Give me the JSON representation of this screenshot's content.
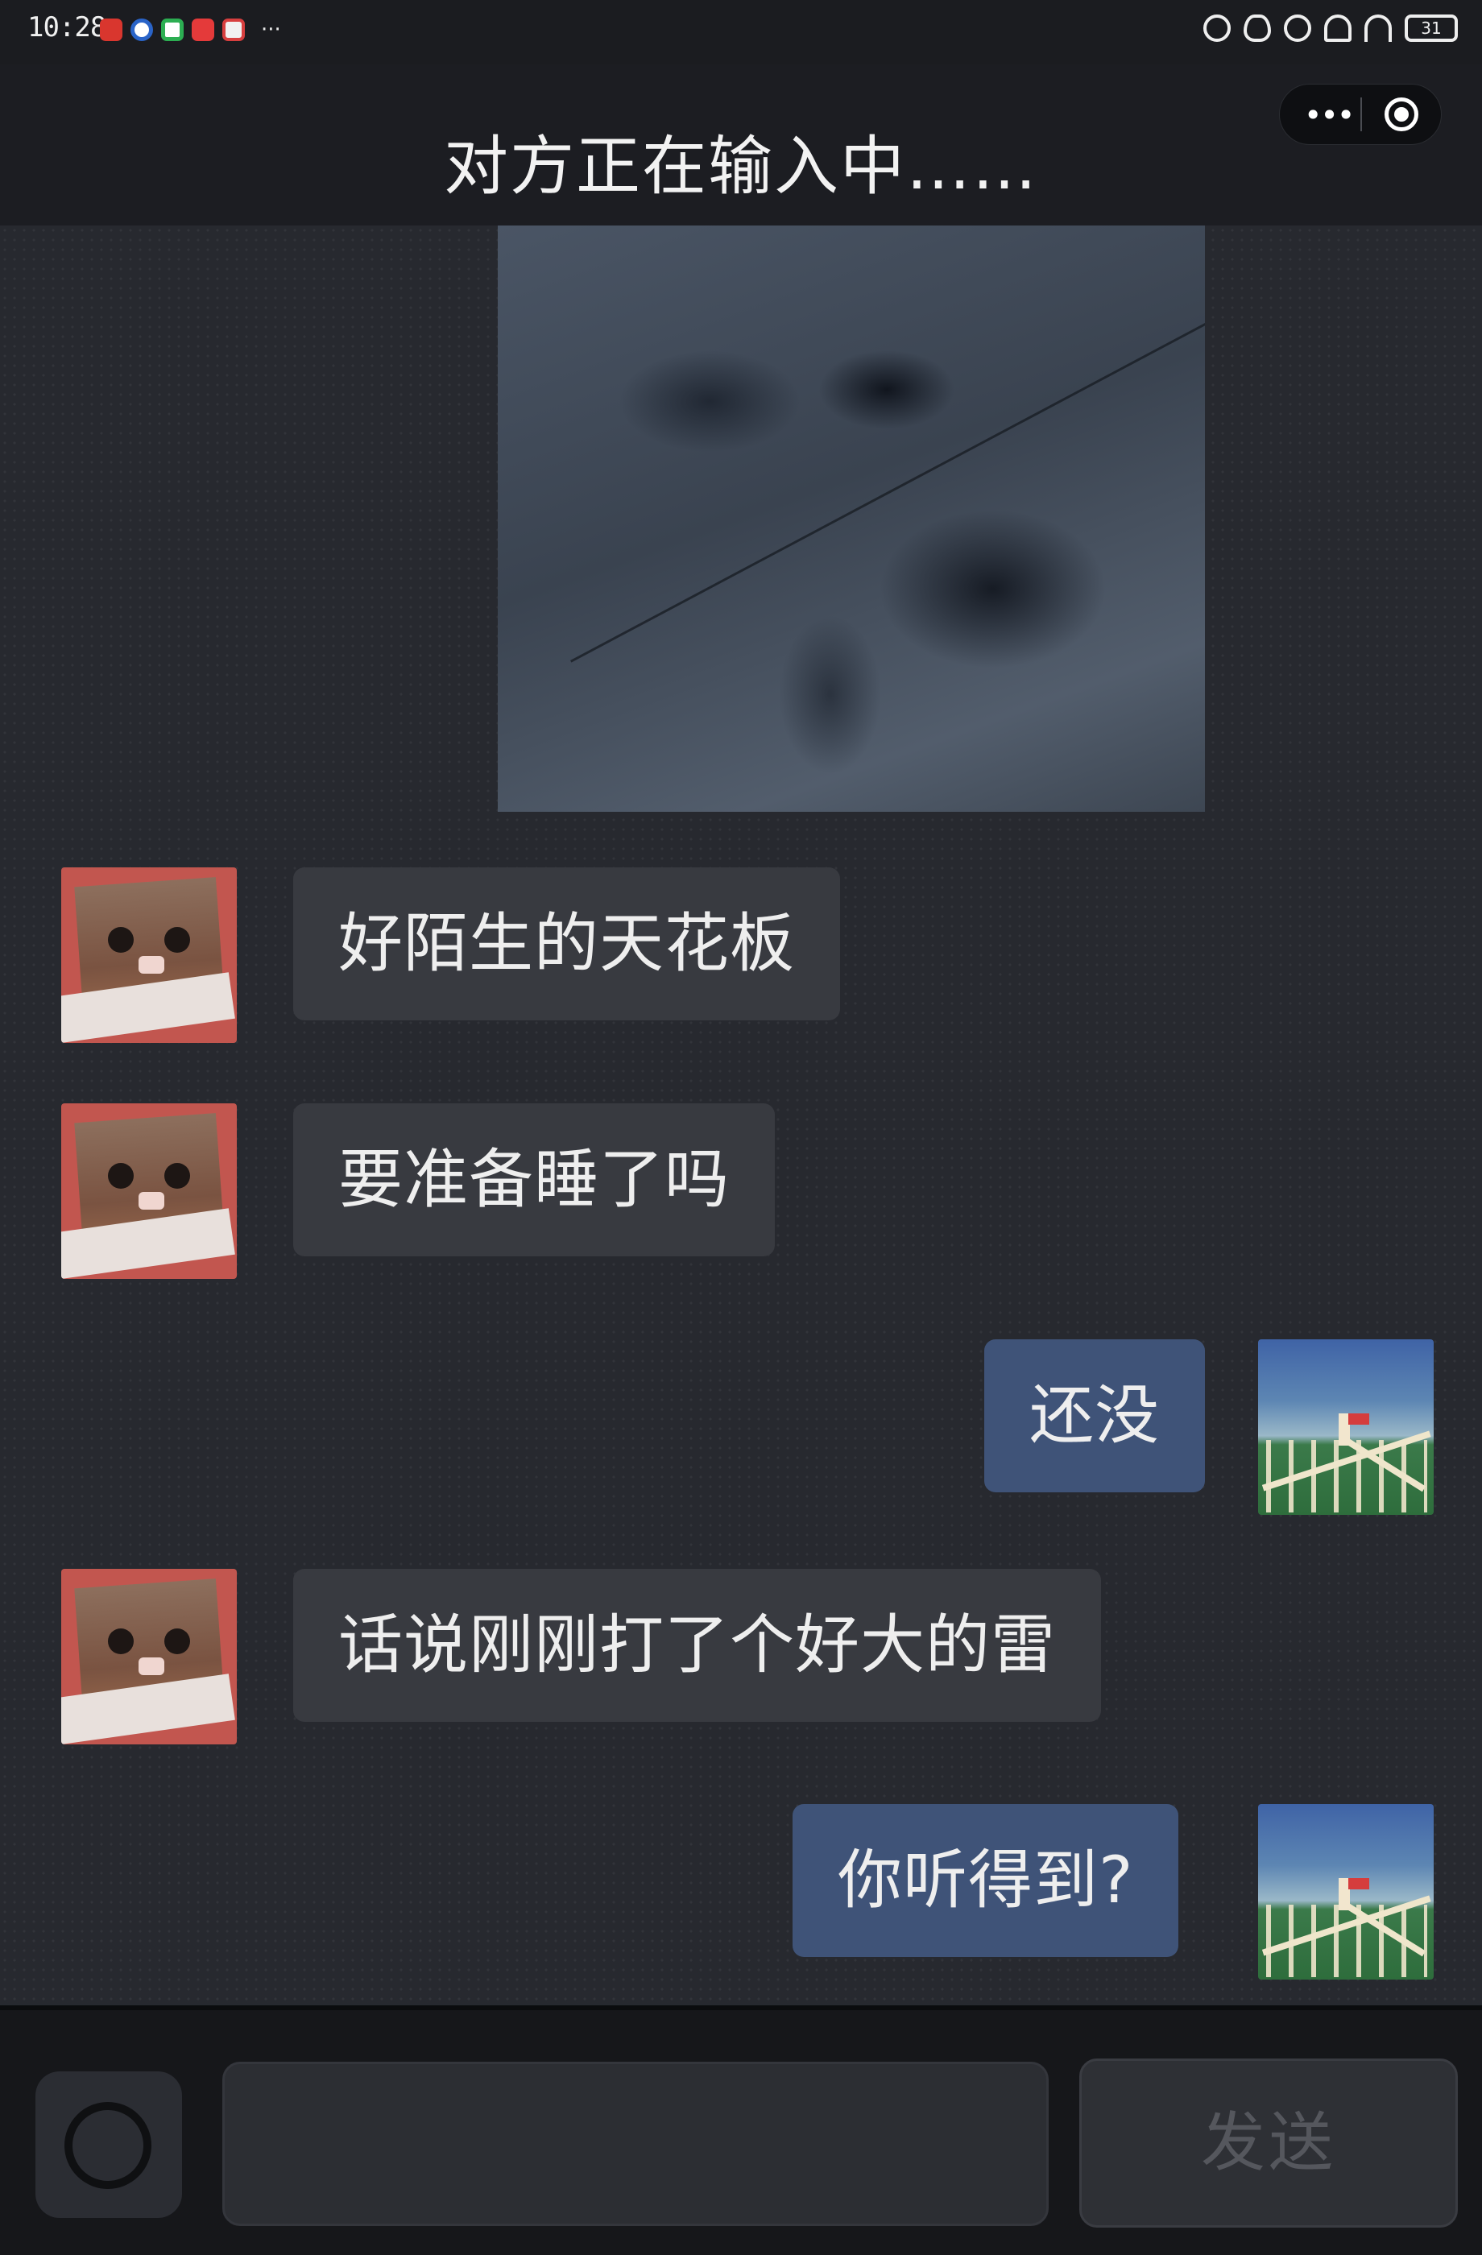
{
  "status_bar": {
    "time": "10:28",
    "battery": "31"
  },
  "header": {
    "title": "对方正在输入中……",
    "capsule_more_icon": "more-dots-icon",
    "capsule_close_icon": "target-circle-icon"
  },
  "messages": [
    {
      "from": "other",
      "text": "好陌生的天花板"
    },
    {
      "from": "other",
      "text": "要准备睡了吗"
    },
    {
      "from": "me",
      "text": "还没"
    },
    {
      "from": "other",
      "text": "话说刚刚打了个好大的雷"
    },
    {
      "from": "me",
      "text": "你听得到?"
    }
  ],
  "input": {
    "placeholder": "",
    "send_label": "发送",
    "camera_icon": "camera-icon"
  }
}
